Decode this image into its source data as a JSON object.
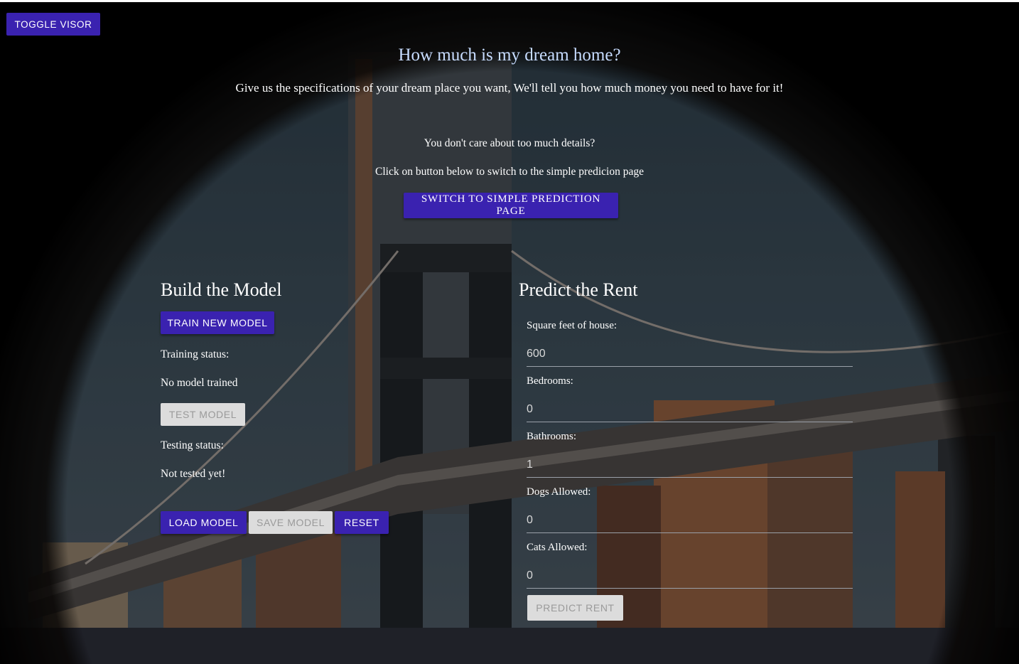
{
  "toolbar": {
    "toggle_visor_label": "Toggle Visor"
  },
  "header": {
    "title": "How much is my dream home?",
    "subtitle": "Give us the specifications of your dream place you want, We'll tell you how much money you need to have for it!",
    "simple_prompt": "You don't care about too much details?",
    "simple_hint": "Click on button below to switch to the simple predicion page",
    "switch_label": "Switch to simple prediction page"
  },
  "build": {
    "heading": "Build the Model",
    "train_label": "Train New Model",
    "training_status_label": "Training status:",
    "training_status_value": "No model trained",
    "test_label": "Test Model",
    "testing_status_label": "Testing status:",
    "testing_status_value": "Not tested yet!",
    "load_label": "Load Model",
    "save_label": "Save Model",
    "reset_label": "Reset"
  },
  "predict": {
    "heading": "Predict the Rent",
    "fields": [
      {
        "label": "Square feet of house:",
        "value": "600"
      },
      {
        "label": "Bedrooms:",
        "value": "0"
      },
      {
        "label": "Bathrooms:",
        "value": "1"
      },
      {
        "label": "Dogs Allowed:",
        "value": "0"
      },
      {
        "label": "Cats Allowed:",
        "value": "0"
      }
    ],
    "predict_label": "Predict Rent"
  },
  "colors": {
    "primary": "#3a22b0",
    "title": "#c7dcff",
    "disabled": "#dcdcdc"
  }
}
